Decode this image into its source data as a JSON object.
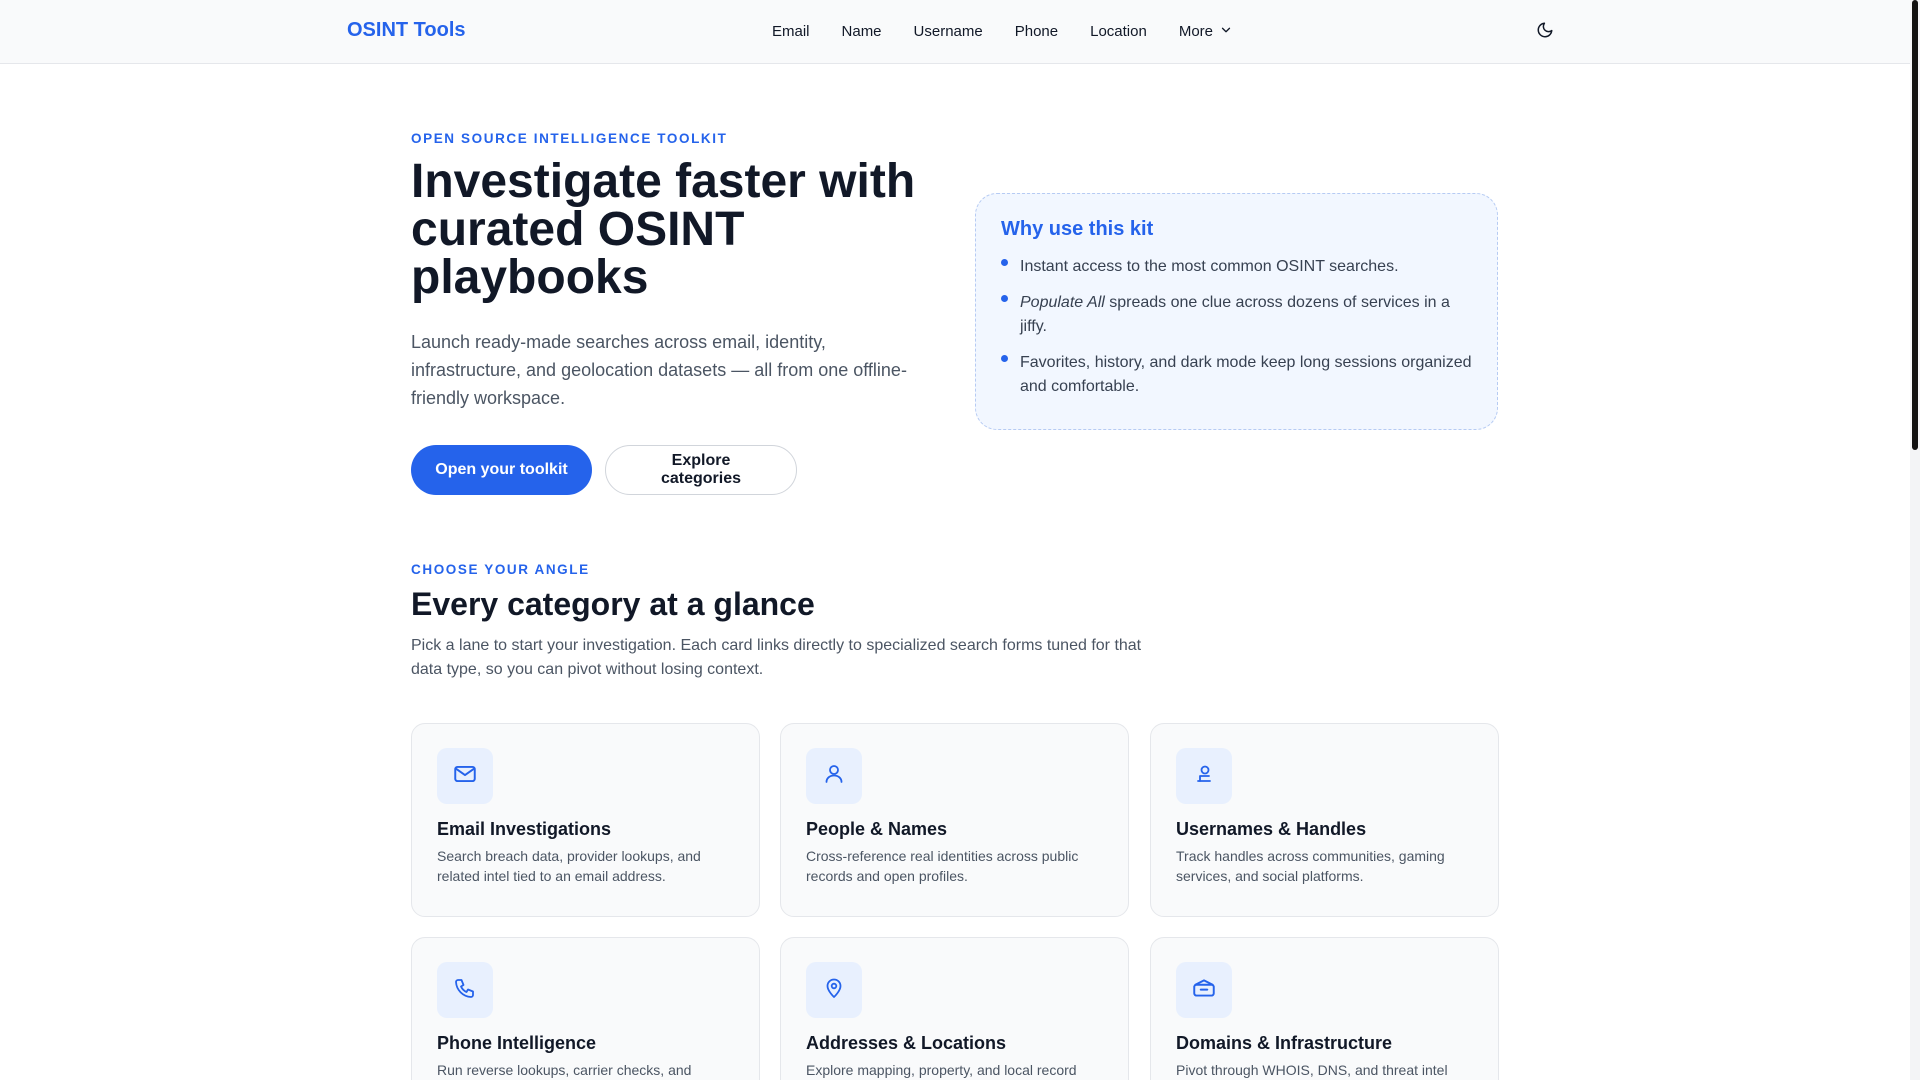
{
  "nav": {
    "brand": "OSINT Tools",
    "links": [
      "Email",
      "Name",
      "Username",
      "Phone",
      "Location"
    ],
    "more_label": "More"
  },
  "hero": {
    "eyebrow": "Open source intelligence toolkit",
    "title": "Investigate faster with curated OSINT playbooks",
    "description": "Launch ready-made searches across email, identity, infrastructure, and geolocation datasets — all from one offline-friendly workspace.",
    "primary_button": "Open your toolkit",
    "secondary_button": "Explore categories"
  },
  "why": {
    "title": "Why use this kit",
    "items": [
      {
        "emphasis": "",
        "text": "Instant access to the most common OSINT searches."
      },
      {
        "emphasis": "Populate All",
        "text": " spreads one clue across dozens of services in a jiffy."
      },
      {
        "emphasis": "",
        "text": "Favorites, history, and dark mode keep long sessions organized and comfortable."
      }
    ]
  },
  "categories": {
    "eyebrow": "Choose your angle",
    "title": "Every category at a glance",
    "description": "Pick a lane to start your investigation. Each card links directly to specialized search forms tuned for that data type, so you can pivot without losing context.",
    "cards": [
      {
        "icon": "mail-icon",
        "title": "Email Investigations",
        "description": "Search breach data, provider lookups, and related intel tied to an email address."
      },
      {
        "icon": "person-icon",
        "title": "People & Names",
        "description": "Cross-reference real identities across public records and open profiles."
      },
      {
        "icon": "handle-icon",
        "title": "Usernames & Handles",
        "description": "Track handles across communities, gaming services, and social platforms."
      },
      {
        "icon": "phone-icon",
        "title": "Phone Intelligence",
        "description": "Run reverse lookups, carrier checks, and"
      },
      {
        "icon": "map-pin-icon",
        "title": "Addresses & Locations",
        "description": "Explore mapping, property, and local record"
      },
      {
        "icon": "server-icon",
        "title": "Domains & Infrastructure",
        "description": "Pivot through WHOIS, DNS, and threat intel"
      }
    ]
  },
  "colors": {
    "accent": "#2563eb",
    "heading": "#111827",
    "body_text": "#4b5563",
    "why_background": "#f2f7ff",
    "card_background": "#f9fafb",
    "icon_tile": "#e8f0fe"
  }
}
